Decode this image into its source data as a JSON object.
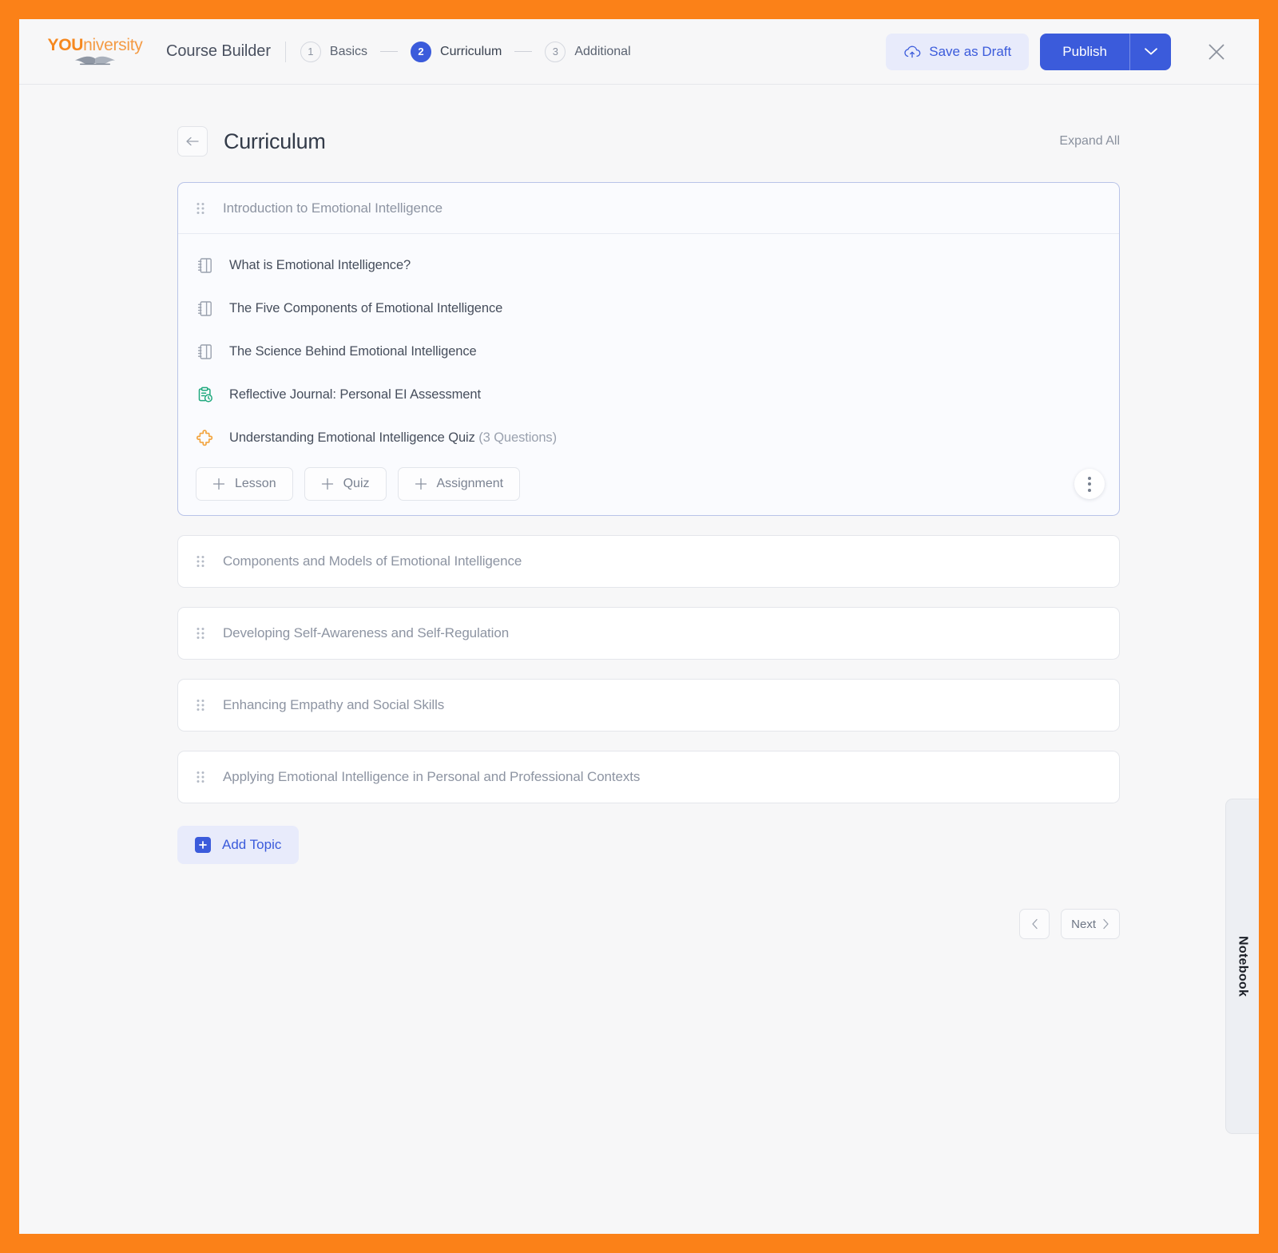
{
  "brand": {
    "bold": "YOU",
    "rest": "niversity"
  },
  "header": {
    "app_title": "Course Builder",
    "steps": [
      {
        "num": "1",
        "label": "Basics",
        "active": false
      },
      {
        "num": "2",
        "label": "Curriculum",
        "active": true
      },
      {
        "num": "3",
        "label": "Additional",
        "active": false
      }
    ],
    "save_draft_label": "Save as Draft",
    "publish_label": "Publish",
    "publish_caret_icon": "chevron-down-icon",
    "close_icon": "close-icon",
    "save_draft_icon": "cloud-upload-icon"
  },
  "page": {
    "back_icon": "arrow-left-icon",
    "title": "Curriculum",
    "expand_all": "Expand All"
  },
  "topics": [
    {
      "title": "Introduction to Emotional Intelligence",
      "open": true,
      "items": [
        {
          "icon": "lesson-book-icon",
          "type": "lesson",
          "label": "What is Emotional Intelligence?",
          "meta": ""
        },
        {
          "icon": "lesson-book-icon",
          "type": "lesson",
          "label": "The Five Components of Emotional Intelligence",
          "meta": ""
        },
        {
          "icon": "lesson-book-icon",
          "type": "lesson",
          "label": "The Science Behind Emotional Intelligence",
          "meta": ""
        },
        {
          "icon": "assignment-clipboard-icon",
          "type": "assignment",
          "label": "Reflective Journal: Personal EI Assessment",
          "meta": ""
        },
        {
          "icon": "quiz-puzzle-icon",
          "type": "quiz",
          "label": "Understanding Emotional Intelligence Quiz",
          "meta": "(3 Questions)"
        }
      ],
      "actions": [
        {
          "label": "Lesson"
        },
        {
          "label": "Quiz"
        },
        {
          "label": "Assignment"
        }
      ],
      "kebab_icon": "more-vertical-icon"
    },
    {
      "title": "Components and Models of Emotional Intelligence",
      "open": false
    },
    {
      "title": "Developing Self-Awareness and Self-Regulation",
      "open": false
    },
    {
      "title": "Enhancing Empathy and Social Skills",
      "open": false
    },
    {
      "title": "Applying Emotional Intelligence in Personal and Professional Contexts",
      "open": false
    }
  ],
  "add_topic": {
    "label": "Add Topic",
    "icon": "plus-square-icon"
  },
  "pagination": {
    "prev_icon": "chevron-left-icon",
    "next_label": "Next",
    "next_icon": "chevron-right-icon"
  },
  "notebook": {
    "label": "Notebook"
  },
  "colors": {
    "page_border": "#FB8118",
    "brand_orange": "#F6881F",
    "accent_blue": "#3B5BDB",
    "accent_blue_soft": "#E8EBFB",
    "assignment_green": "#1FA97E",
    "quiz_orange": "#F2A33C",
    "canvas": "#F7F7F8"
  }
}
